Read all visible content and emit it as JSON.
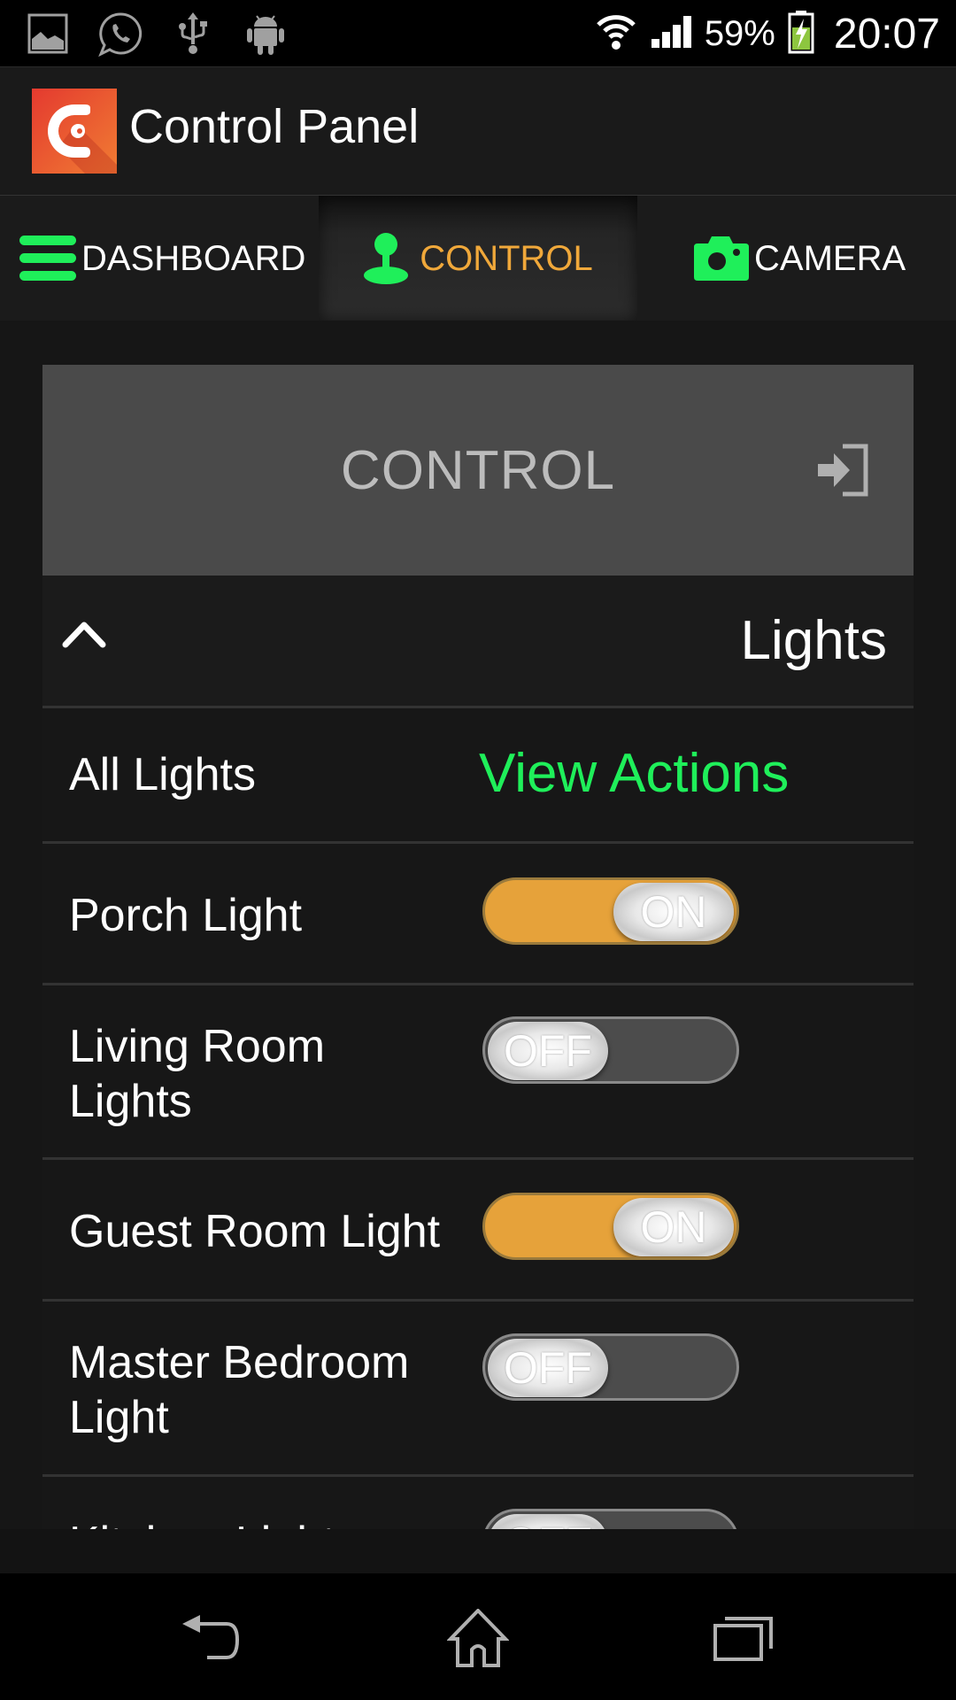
{
  "status_bar": {
    "notification_icons": [
      "image-icon",
      "whatsapp-icon",
      "usb-icon",
      "android-icon"
    ],
    "wifi_icon": "wifi-icon",
    "signal_icon": "signal-icon",
    "battery_percent": "59%",
    "battery_icon": "battery-charging-icon",
    "time": "20:07"
  },
  "app_bar": {
    "title": "Control Panel",
    "logo_icon": "app-logo-icon"
  },
  "tabs": [
    {
      "label": "DASHBOARD",
      "icon": "menu-icon",
      "active": false
    },
    {
      "label": "CONTROL",
      "icon": "joystick-icon",
      "active": true
    },
    {
      "label": "CAMERA",
      "icon": "camera-icon",
      "active": false
    }
  ],
  "control_card": {
    "title": "CONTROL",
    "icon": "enter-icon"
  },
  "section": {
    "title": "Lights",
    "expanded": true,
    "collapse_icon": "chevron-up-icon"
  },
  "rows": [
    {
      "label": "All Lights",
      "action": "View Actions"
    },
    {
      "label": "Porch Light",
      "state": "ON"
    },
    {
      "label": "Living Room Lights",
      "state": "OFF"
    },
    {
      "label": "Guest Room Light",
      "state": "ON"
    },
    {
      "label": "Master Bedroom Light",
      "state": "OFF"
    },
    {
      "label": "Kitchen Light",
      "state": "OFF"
    }
  ],
  "colors": {
    "accent_green": "#1fef5a",
    "active_tab_orange": "#f0a83a",
    "toggle_on": "#e6a23a",
    "toggle_off": "#4c4c4c"
  },
  "nav_bar": {
    "back_icon": "back-icon",
    "home_icon": "home-icon",
    "recents_icon": "recents-icon"
  }
}
